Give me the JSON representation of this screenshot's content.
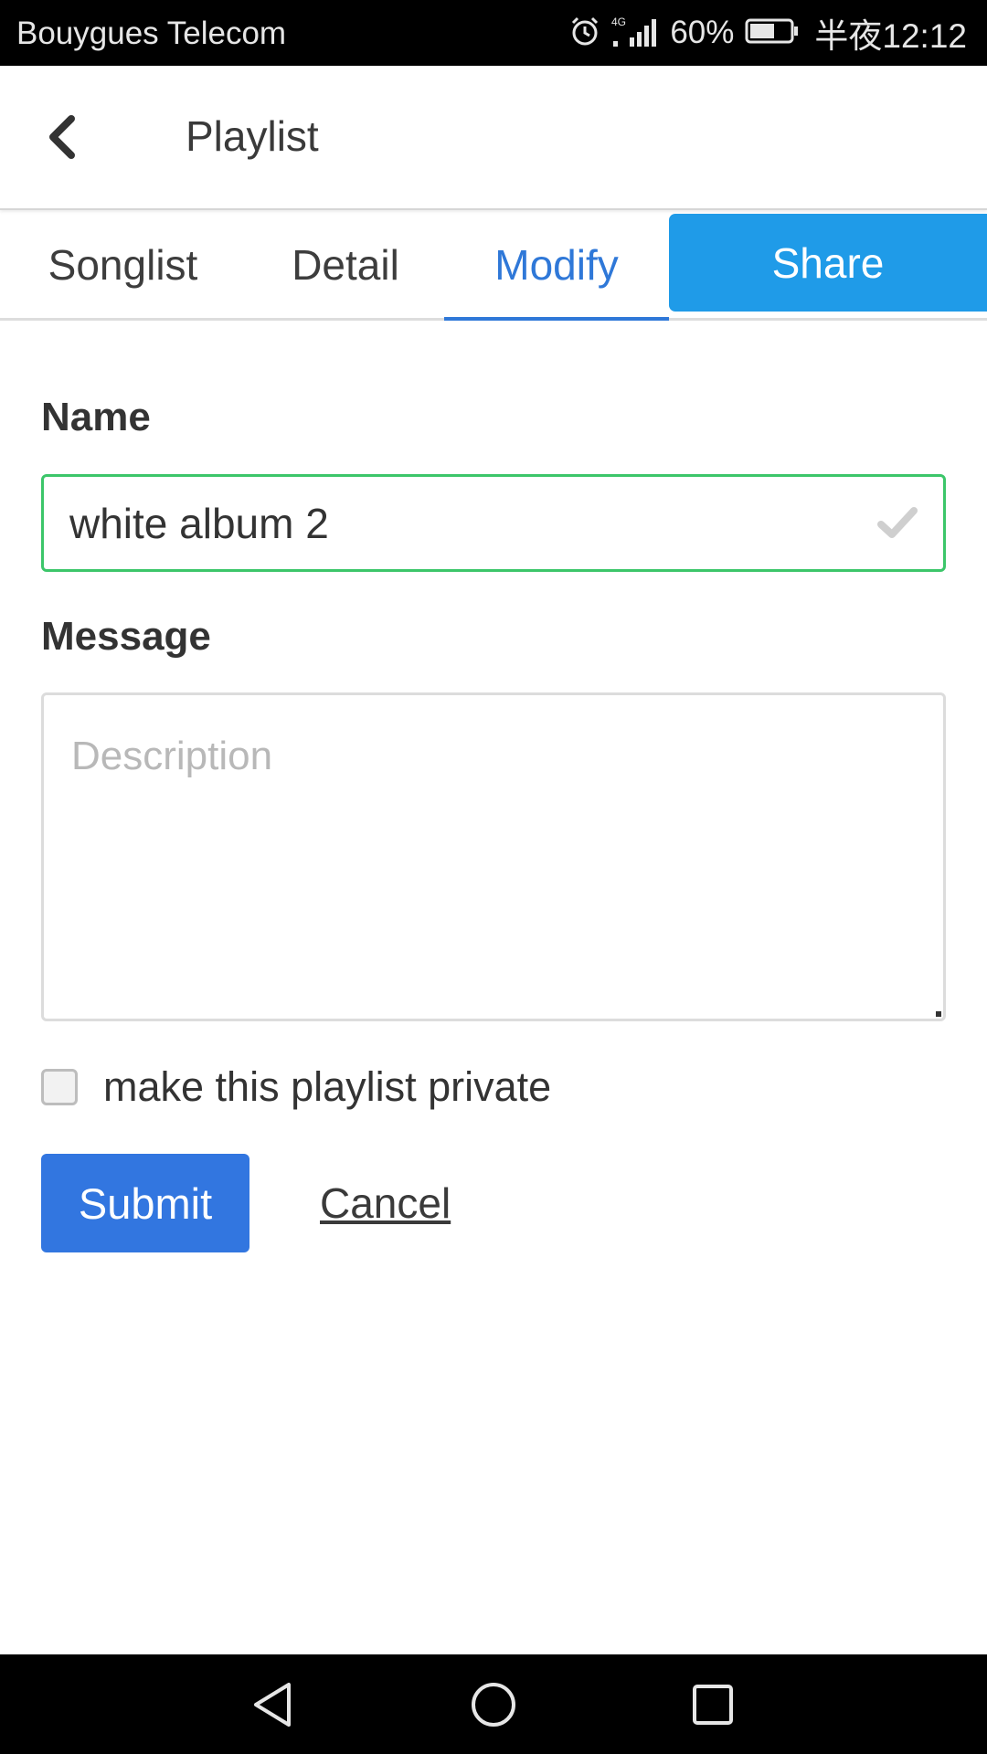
{
  "status_bar": {
    "carrier": "Bouygues Telecom",
    "network": "4G",
    "battery_percent": "60%",
    "time": "半夜12:12",
    "icons": [
      "alarm-icon",
      "signal-icon",
      "battery-icon"
    ]
  },
  "header": {
    "title": "Playlist",
    "back_icon": "chevron-left-icon"
  },
  "tabs": [
    {
      "label": "Songlist",
      "active": false
    },
    {
      "label": "Detail",
      "active": false
    },
    {
      "label": "Modify",
      "active": true
    },
    {
      "label": "Share",
      "active": false,
      "highlighted": true
    }
  ],
  "form": {
    "name_label": "Name",
    "name_value": "white album 2",
    "name_valid_icon": "checkmark-icon",
    "message_label": "Message",
    "message_placeholder": "Description",
    "message_value": "",
    "private_label": "make this playlist private",
    "private_checked": false,
    "submit_label": "Submit",
    "cancel_label": "Cancel"
  },
  "nav_bar": {
    "icons": [
      "nav-back-icon",
      "nav-home-icon",
      "nav-recents-icon"
    ]
  },
  "colors": {
    "accent": "#2f78d8",
    "share_tab": "#1f9be8",
    "submit": "#3276e0",
    "valid_border": "#3cc66a"
  }
}
